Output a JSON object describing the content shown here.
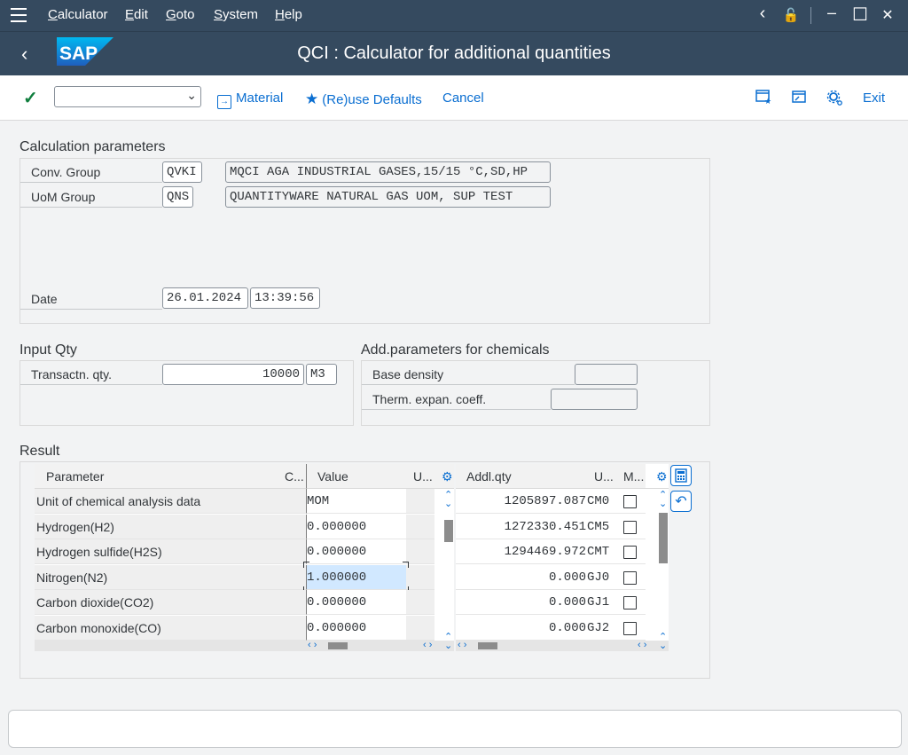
{
  "menu": {
    "items": [
      "Calculator",
      "Edit",
      "Goto",
      "System",
      "Help"
    ]
  },
  "window_controls": {
    "back": "‹",
    "unlock": "🔓",
    "minimize": "–",
    "maximize": "☐",
    "close": "✕"
  },
  "header": {
    "logo": "SAP",
    "title": "QCI : Calculator for additional quantities"
  },
  "toolbar": {
    "command_value": "",
    "material_label": "Material",
    "defaults_label": "(Re)use Defaults",
    "cancel_label": "Cancel",
    "exit_label": "Exit"
  },
  "calc_params": {
    "title": "Calculation parameters",
    "conv_group_label": "Conv. Group",
    "conv_group_value": "QVKI",
    "conv_group_desc": "MQCI AGA INDUSTRIAL GASES,15/15 °C,SD,HP",
    "uom_group_label": "UoM Group",
    "uom_group_value": "QNS",
    "uom_group_desc": "QUANTITYWARE NATURAL GAS UOM, SUP TEST",
    "date_label": "Date",
    "date_value": "26.01.2024",
    "time_value": "13:39:56"
  },
  "input_qty": {
    "title": "Input Qty",
    "transactn_label": "Transactn. qty.",
    "transactn_value": "10000",
    "transactn_unit": "M3"
  },
  "chem_params": {
    "title": "Add.parameters for chemicals",
    "base_density_label": "Base density",
    "base_density_value": "",
    "therm_label": "Therm. expan. coeff.",
    "therm_value": ""
  },
  "result": {
    "title": "Result",
    "headers": {
      "parameter": "Parameter",
      "c": "C...",
      "value": "Value",
      "u": "U...",
      "addl_qty": "Addl.qty",
      "u2": "U...",
      "m": "M..."
    },
    "rows": [
      {
        "param": "Unit of chemical analysis data",
        "value": "MOM",
        "addl": "1205897.087",
        "unit": "CM0"
      },
      {
        "param": "Hydrogen(H2)",
        "value": "0.000000",
        "addl": "1272330.451",
        "unit": "CM5"
      },
      {
        "param": "Hydrogen sulfide(H2S)",
        "value": "0.000000",
        "addl": "1294469.972",
        "unit": "CMT"
      },
      {
        "param": "Nitrogen(N2)",
        "value": "1.000000",
        "addl": "0.000",
        "unit": "GJ0"
      },
      {
        "param": "Carbon dioxide(CO2)",
        "value": "0.000000",
        "addl": "0.000",
        "unit": "GJ1"
      },
      {
        "param": "Carbon monoxide(CO)",
        "value": "0.000000",
        "addl": "0.000",
        "unit": "GJ2"
      }
    ]
  },
  "colors": {
    "shell": "#354a5f",
    "accent": "#0a6ed1",
    "success": "#107e3e",
    "selected_cell": "#d1e8ff"
  }
}
